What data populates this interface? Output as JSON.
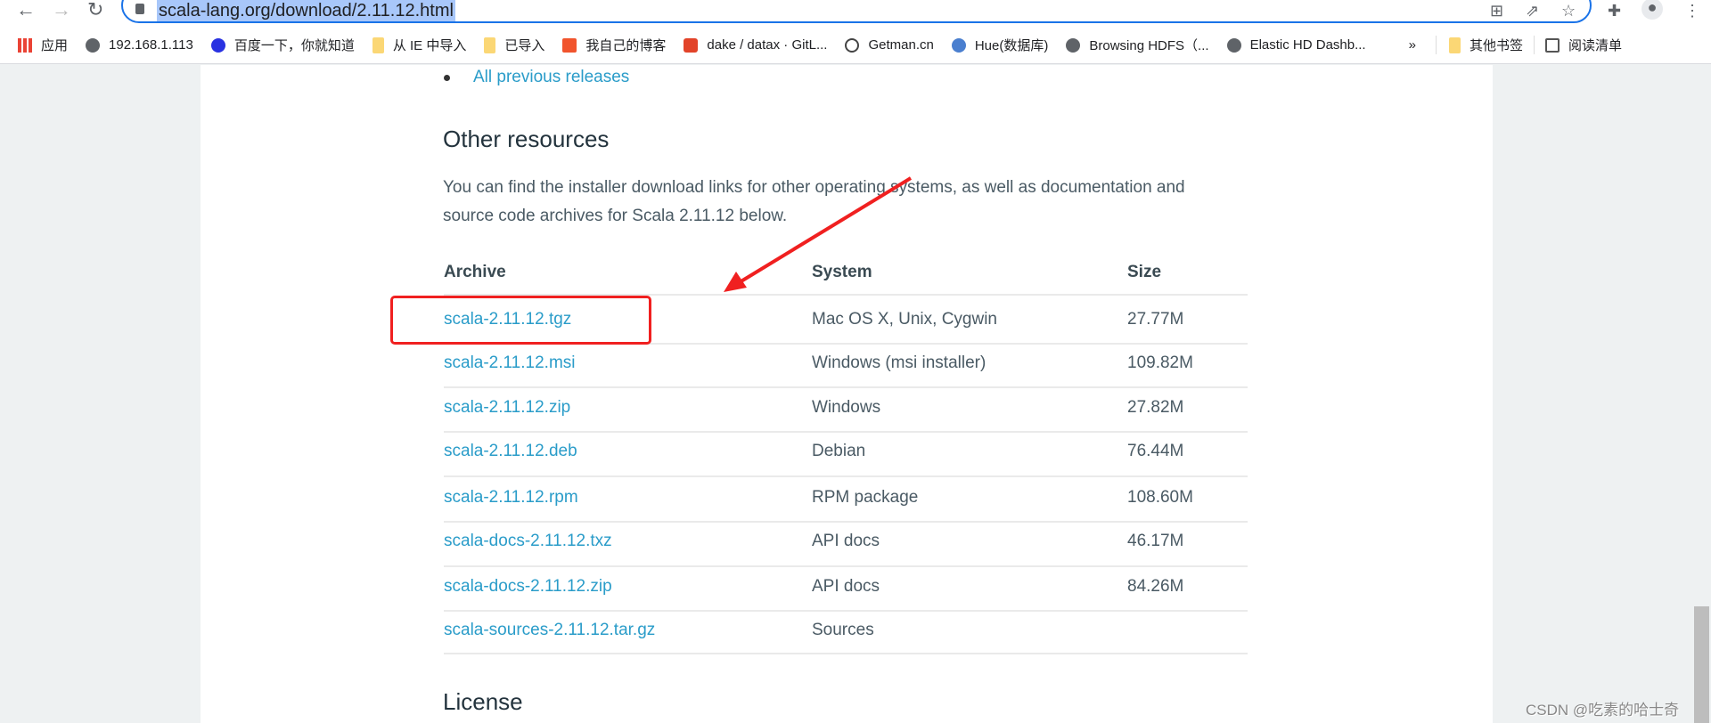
{
  "browser": {
    "url": "scala-lang.org/download/2.11.12.html",
    "bookmarks": [
      {
        "label": "应用",
        "icon": "apps-grid-icon"
      },
      {
        "label": "192.168.1.113",
        "icon": "globe-icon"
      },
      {
        "label": "百度一下，你就知道",
        "icon": "baidu-icon"
      },
      {
        "label": "从 IE 中导入",
        "icon": "folder-icon"
      },
      {
        "label": "已导入",
        "icon": "folder-icon"
      },
      {
        "label": "我自己的博客",
        "icon": "csdn-icon"
      },
      {
        "label": "dake / datax · GitL...",
        "icon": "gitlab-icon"
      },
      {
        "label": "Getman.cn",
        "icon": "g-icon"
      },
      {
        "label": "Hue(数据库)",
        "icon": "hue-icon"
      },
      {
        "label": "Browsing HDFS（...",
        "icon": "globe-icon"
      },
      {
        "label": "Elastic HD Dashb...",
        "icon": "globe-icon"
      }
    ],
    "overflow": "»",
    "other_bookmarks": "其他书签",
    "reading_list": "阅读清单"
  },
  "page": {
    "previous_releases": "All previous releases",
    "other_resources_heading": "Other resources",
    "paragraph_line1": "You can find the installer download links for other operating systems, as well as documentation and",
    "paragraph_line2": "source code archives for Scala 2.11.12 below.",
    "table": {
      "headers": [
        "Archive",
        "System",
        "Size"
      ],
      "rows": [
        {
          "archive": "scala-2.11.12.tgz",
          "system": "Mac OS X, Unix, Cygwin",
          "size": "27.77M"
        },
        {
          "archive": "scala-2.11.12.msi",
          "system": "Windows (msi installer)",
          "size": "109.82M"
        },
        {
          "archive": "scala-2.11.12.zip",
          "system": "Windows",
          "size": "27.82M"
        },
        {
          "archive": "scala-2.11.12.deb",
          "system": "Debian",
          "size": "76.44M"
        },
        {
          "archive": "scala-2.11.12.rpm",
          "system": "RPM package",
          "size": "108.60M"
        },
        {
          "archive": "scala-docs-2.11.12.txz",
          "system": "API docs",
          "size": "46.17M"
        },
        {
          "archive": "scala-docs-2.11.12.zip",
          "system": "API docs",
          "size": "84.26M"
        },
        {
          "archive": "scala-sources-2.11.12.tar.gz",
          "system": "Sources",
          "size": ""
        }
      ]
    },
    "license_heading": "License"
  },
  "annotation_color": "#f02020",
  "link_color": "#2a9cc9",
  "watermark": "CSDN @吃素的哈士奇"
}
